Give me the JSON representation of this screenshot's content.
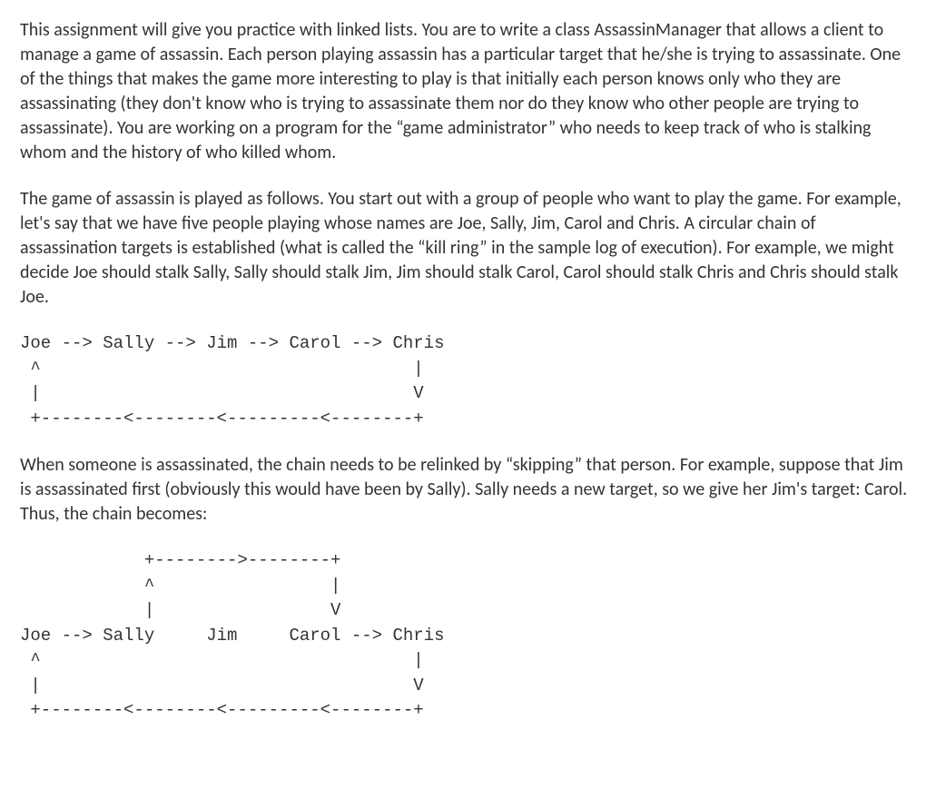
{
  "paragraphs": {
    "p1": "This assignment will give you practice with linked lists. You are to write a class AssassinManager that allows a client to manage a game of assassin. Each person playing assassin has a particular target that he/she is trying to assassinate. One of the things that makes the game more interesting to play is that initially each person knows only who they are assassinating (they don't know who is trying to assassinate them nor do they know who other people are trying to assassinate). You are working on a program for the “game administrator” who needs to keep track of who is stalking whom and the history of who killed whom.",
    "p2": "The game of assassin is played as follows. You start out with a group of people who want to play the game. For example, let's say that we have five people playing whose names are Joe, Sally, Jim, Carol and Chris. A circular chain of assassination targets is established (what is called the “kill ring” in the sample log of execution). For example, we might decide Joe should stalk Sally, Sally should stalk Jim, Jim should stalk Carol, Carol should stalk Chris and Chris should stalk Joe.",
    "p3": "When someone is assassinated, the chain needs to be relinked by “skipping” that person. For example, suppose that Jim is assassinated first (obviously this would have been by Sally). Sally needs a new target, so we give her Jim's target: Carol. Thus, the chain becomes:"
  },
  "diagrams": {
    "d1": "Joe --> Sally --> Jim --> Carol --> Chris\n ^                                    |\n |                                    V\n +--------<--------<---------<--------+",
    "d2": "            +-------->--------+\n            ^                 |\n            |                 V\nJoe --> Sally     Jim     Carol --> Chris\n ^                                    |\n |                                    V\n +--------<--------<---------<--------+"
  }
}
